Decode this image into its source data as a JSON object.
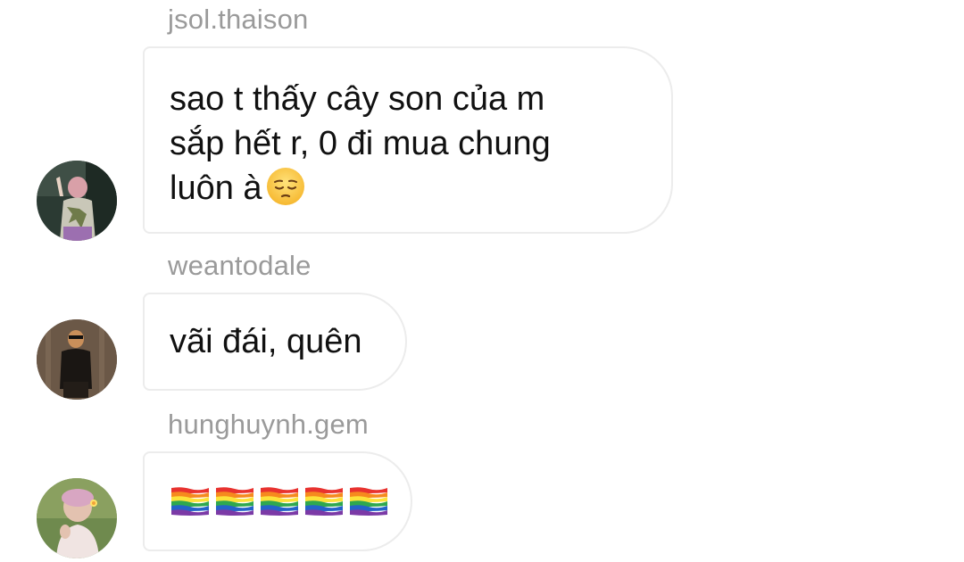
{
  "messages": [
    {
      "username": "jsol.thaison",
      "text": "sao t thấy cây son của m\nsắp hết r, 0 đi mua chung\nluôn à",
      "emoji": "pensive-face-icon"
    },
    {
      "username": "weantodale",
      "text": "vãi đái, quên"
    },
    {
      "username": "hunghuynh.gem",
      "emoji": "rainbow-flag-icon",
      "emoji_count": 5
    }
  ]
}
